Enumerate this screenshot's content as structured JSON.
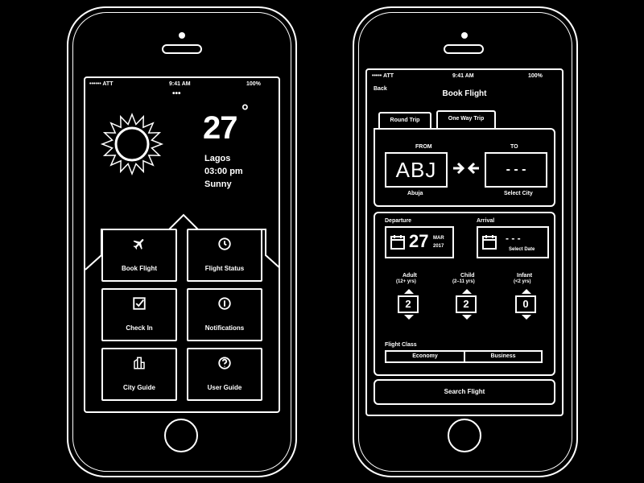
{
  "left_phone": {
    "status_bar": {
      "carrier": "•••••• ATT",
      "time": "9:41 AM",
      "battery": "100%"
    },
    "page_dots": "•••",
    "weather": {
      "temperature": "27",
      "degree_symbol": "°",
      "city": "Lagos",
      "time": "03:00 pm",
      "condition": "Sunny",
      "icon": "sun-icon"
    },
    "menu": [
      {
        "label": "Book Flight",
        "icon": "airplane-icon"
      },
      {
        "label": "Flight Status",
        "icon": "clock-icon"
      },
      {
        "label": "Check In",
        "icon": "checkbox-icon"
      },
      {
        "label": "Notifications",
        "icon": "info-icon"
      },
      {
        "label": "City Guide",
        "icon": "city-icon"
      },
      {
        "label": "User Guide",
        "icon": "question-icon"
      }
    ]
  },
  "right_phone": {
    "status_bar": {
      "carrier": "••••• ATT",
      "time": "9:41 AM",
      "battery": "100%"
    },
    "back_label": "Back",
    "title": "Book Flight",
    "tabs": [
      {
        "label": "Round Trip",
        "active": true
      },
      {
        "label": "One Way Trip",
        "active": false
      }
    ],
    "route": {
      "from_label": "FROM",
      "from_code": "ABJ",
      "from_city": "Abuja",
      "to_label": "TO",
      "to_code": "- - -",
      "to_city": "Select City"
    },
    "departure": {
      "label": "Departure",
      "day": "27",
      "month": "MAR",
      "year": "2017"
    },
    "arrival": {
      "label": "Arrival",
      "value": "- - -",
      "sub": "Select Date"
    },
    "passengers": [
      {
        "label": "Adult",
        "sub": "(12+ yrs)",
        "value": "2"
      },
      {
        "label": "Child",
        "sub": "(2–11 yrs)",
        "value": "2"
      },
      {
        "label": "Infant",
        "sub": "(<2 yrs)",
        "value": "0"
      }
    ],
    "flight_class": {
      "label": "Flight Class",
      "options": [
        "Economy",
        "Business"
      ]
    },
    "search_button": "Search Flight"
  }
}
